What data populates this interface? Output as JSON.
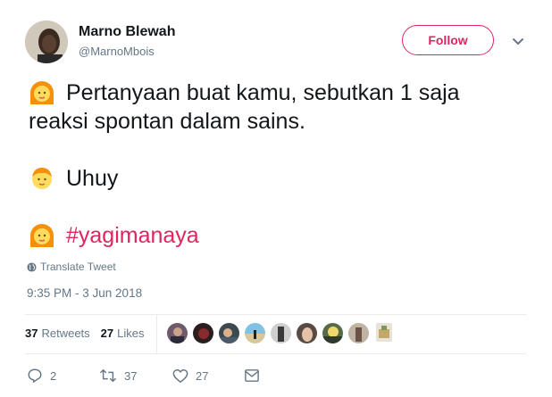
{
  "author": {
    "name": "Marno Blewah",
    "handle": "@MarnoMbois"
  },
  "header": {
    "follow_label": "Follow"
  },
  "tweet": {
    "line1": "Pertanyaan buat kamu, sebutkan 1 saja",
    "line2": "reaksi spontan dalam sains.",
    "line3": "Uhuy",
    "hashtag": "#yagimanaya"
  },
  "translate_label": "Translate Tweet",
  "timestamp": "9:35 PM - 3 Jun 2018",
  "stats": {
    "retweets_count": "37",
    "retweets_label": "Retweets",
    "likes_count": "27",
    "likes_label": "Likes"
  },
  "likers_count_shown": 9,
  "actions": {
    "reply_count": "2",
    "retweet_count": "37",
    "like_count": "27"
  },
  "colors": {
    "accent": "#e0245e",
    "muted": "#657786",
    "text": "#14171a",
    "divider": "#e6ecf0"
  },
  "icons": [
    "caret-down-icon",
    "woman-emoji",
    "boy-emoji",
    "globe-icon",
    "reply-icon",
    "retweet-icon",
    "heart-icon",
    "direct-message-icon"
  ]
}
